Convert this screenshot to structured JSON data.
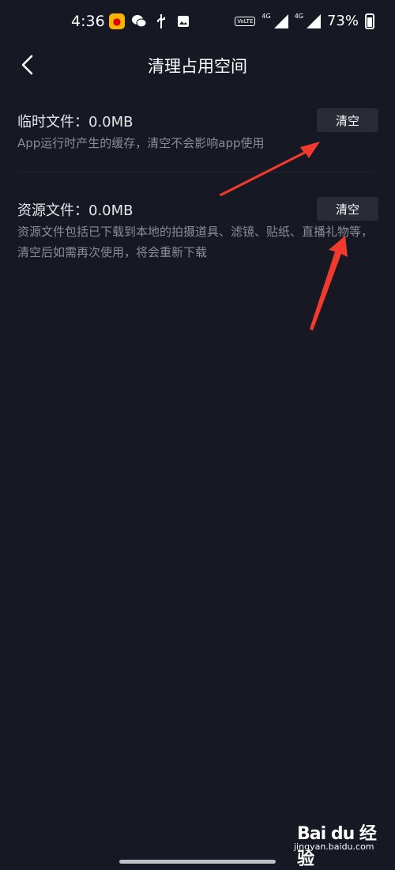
{
  "status_bar": {
    "time": "4:36",
    "net_left": "4G",
    "net_right": "4G",
    "volte": "VoLTE",
    "battery": "73%"
  },
  "header": {
    "title": "清理占用空间",
    "back_icon": "chevron-left-icon"
  },
  "sections": [
    {
      "title": "临时文件：0.0MB",
      "description": "App运行时产生的缓存，清空不会影响app使用",
      "button_label": "清空"
    },
    {
      "title": "资源文件：0.0MB",
      "description": "资源文件包括已下载到本地的拍摄道具、滤镜、贴纸、直播礼物等，清空后如需再次使用，将会重新下载",
      "button_label": "清空"
    }
  ],
  "watermark": {
    "brand": "Bai du 经验",
    "url": "jingyan.baidu.com"
  },
  "colors": {
    "background": "#161823",
    "button_bg": "#2a2b36",
    "annotation_arrow": "#f03a2e"
  }
}
